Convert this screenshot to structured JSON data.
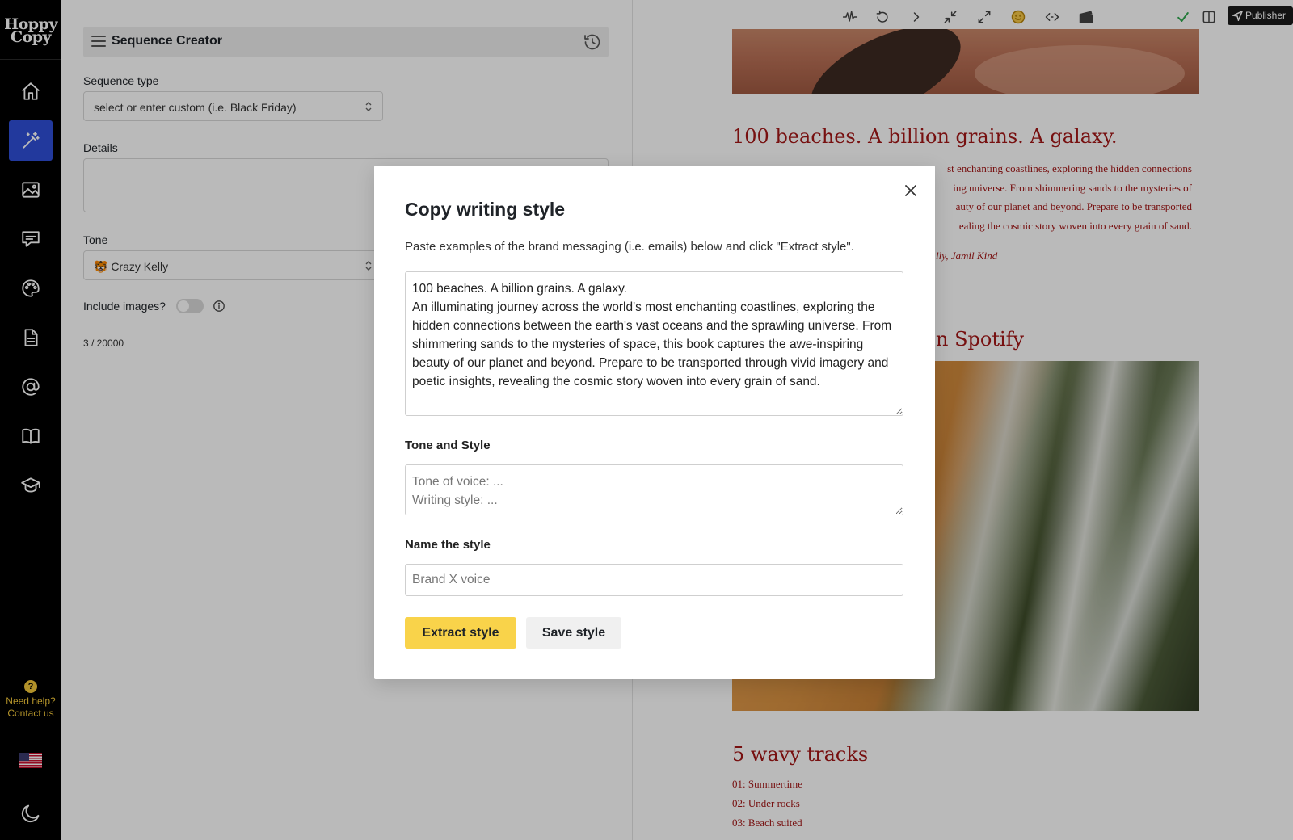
{
  "app": {
    "logo_line1": "Hoppy",
    "logo_line2": "Copy"
  },
  "sidebar": {
    "items": [
      {
        "icon": "home-icon"
      },
      {
        "icon": "magic-wand-icon",
        "active": true
      },
      {
        "icon": "image-icon"
      },
      {
        "icon": "chat-icon"
      },
      {
        "icon": "palette-icon"
      },
      {
        "icon": "document-icon"
      },
      {
        "icon": "at-sign-icon"
      },
      {
        "icon": "book-icon"
      },
      {
        "icon": "graduation-cap-icon"
      }
    ],
    "help_line1": "Need help?",
    "help_line2": "Contact us",
    "active_color": "#2f4fd8",
    "help_color": "#f4c83a"
  },
  "sequence": {
    "title": "Sequence Creator",
    "type_label": "Sequence type",
    "type_value": "select or enter custom (i.e. Black Friday)",
    "details_label": "Details",
    "tone_label": "Tone",
    "tone_value": "🐯 Crazy Kelly",
    "images_label": "Include images?",
    "counter": "3 / 20000"
  },
  "toolbar": {
    "icons": [
      "waveform-icon",
      "undo-icon",
      "chevron-right-icon",
      "collapse-icon",
      "expand-icon",
      "emoji-icon",
      "code-icon",
      "clapper-icon",
      "check-icon",
      "layout-icon"
    ],
    "publisher_label": "Publisher"
  },
  "preview": {
    "heading1": "100 beaches. A billion grains. A galaxy.",
    "body_lines": [
      "st enchanting coastlines, exploring the hidden connections",
      "ing universe. From shimmering sands to the mysteries of",
      "auty of our planet and beyond. Prepare to be transported",
      "ealing the cosmic story woven into every grain of sand."
    ],
    "authors": "lly, Jamil Kind",
    "spotify_heading": "n Spotify",
    "tracks_heading": "5 wavy tracks",
    "tracks": [
      "01: Summertime",
      "02: Under rocks",
      "03: Beach suited"
    ],
    "text_color": "#a31616"
  },
  "modal": {
    "title": "Copy writing style",
    "description": "Paste examples of the brand messaging (i.e. emails) below and click \"Extract style\".",
    "examples_value": "100 beaches. A billion grains. A galaxy.\nAn illuminating journey across the world's most enchanting coastlines, exploring the hidden connections between the earth's vast oceans and the sprawling universe. From shimmering sands to the mysteries of space, this book captures the awe-inspiring beauty of our planet and beyond. Prepare to be transported through vivid imagery and poetic insights, revealing the cosmic story woven into every grain of sand.",
    "tone_label": "Tone and Style",
    "tone_placeholder": "Tone of voice: ...\nWriting style: ...",
    "name_label": "Name the style",
    "name_placeholder": "Brand X voice",
    "extract_label": "Extract style",
    "save_label": "Save style",
    "extract_color": "#f9d34a"
  }
}
